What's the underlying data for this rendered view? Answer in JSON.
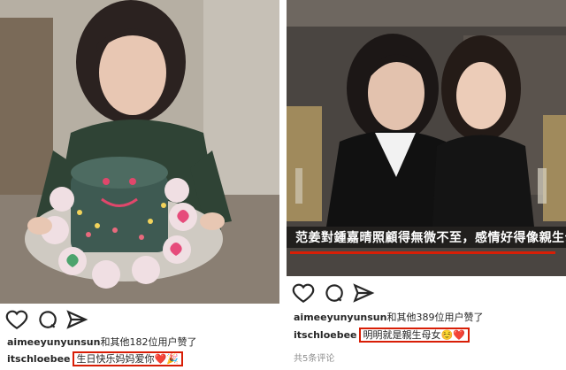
{
  "posts": [
    {
      "side": "left",
      "likes_user": "aimeeyunyunsun",
      "likes_rest": "和其他182位用户赞了",
      "caption_user": "itschloebee",
      "caption_text": "生日快乐妈妈爱你❤️🎉"
    },
    {
      "side": "right",
      "photo_subtitle": "范姜對鍾嘉晴照顧得無微不至，感情好得像親生母女。",
      "likes_user": "aimeeyunyunsun",
      "likes_rest": "和其他389位用户赞了",
      "caption_user": "itschloebee",
      "caption_text": "明明就是親生母女☺️❤️",
      "comments": "共5条评论"
    }
  ],
  "colors": {
    "highlight": "#d81e06",
    "text": "#262626",
    "muted": "#8e8e8e"
  },
  "icons": [
    "heart-icon",
    "comment-icon",
    "share-icon"
  ]
}
